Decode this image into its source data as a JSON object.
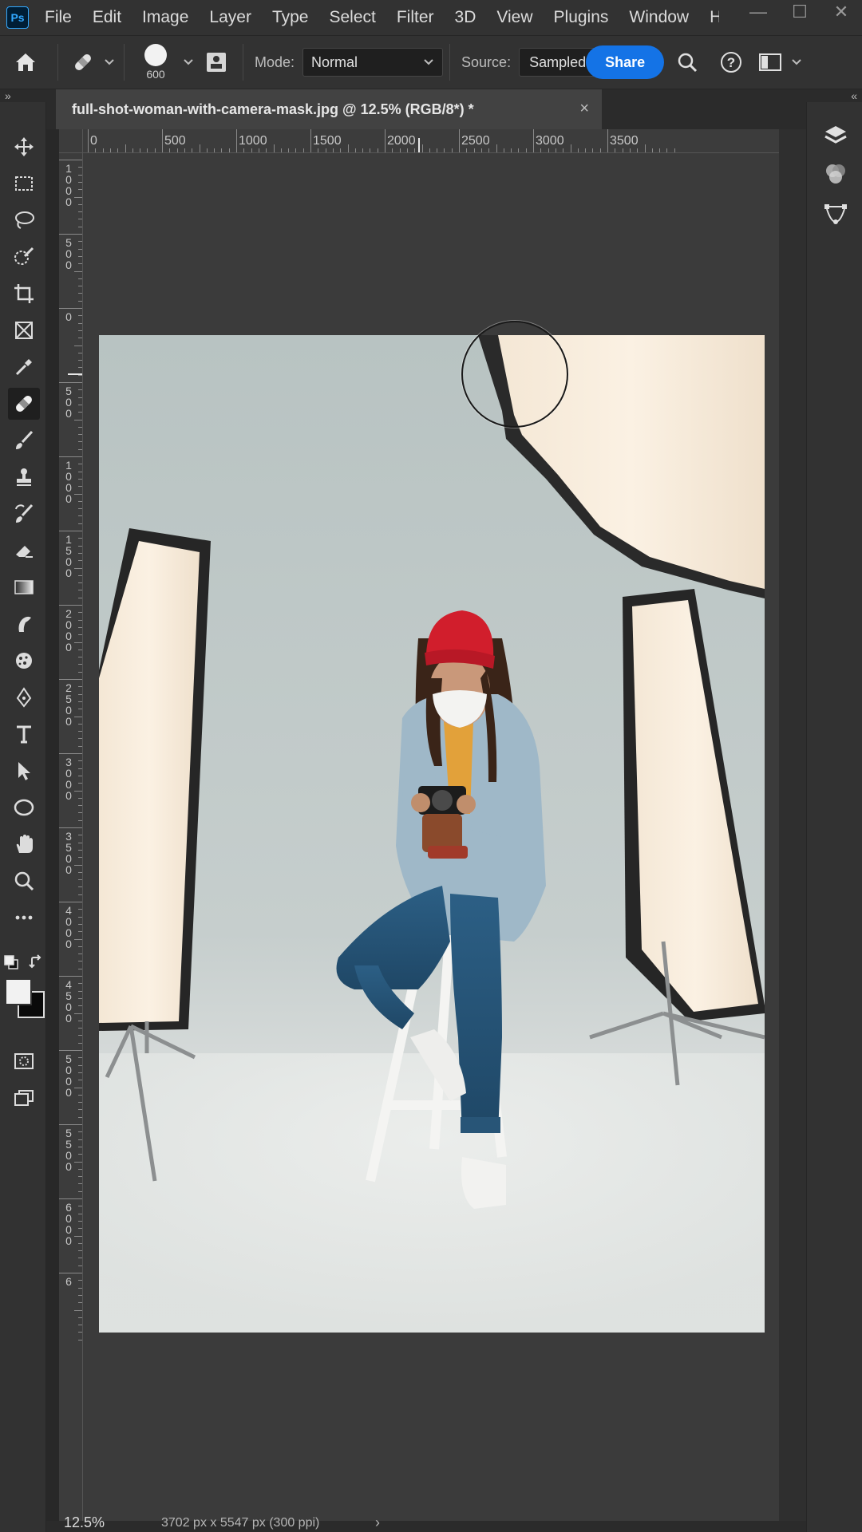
{
  "app": {
    "logo": "Ps"
  },
  "menu": [
    "File",
    "Edit",
    "Image",
    "Layer",
    "Type",
    "Select",
    "Filter",
    "3D",
    "View",
    "Plugins",
    "Window",
    "Help"
  ],
  "window_controls": {
    "minimize": "—",
    "maximize": "☐",
    "close": "✕"
  },
  "options": {
    "brush_size": "600",
    "mode_label": "Mode:",
    "mode_value": "Normal",
    "source_label": "Source:",
    "source_value": "Sampled",
    "share_label": "Share"
  },
  "collapse": {
    "left": "»",
    "right": "«"
  },
  "document": {
    "tab_title": "full-shot-woman-with-camera-mask.jpg @ 12.5% (RGB/8*) *",
    "close_glyph": "×"
  },
  "rulers": {
    "top_labels": [
      "0",
      "500",
      "1000",
      "1500",
      "2000",
      "2500",
      "3000",
      "3500"
    ],
    "left_labels": [
      "1000",
      "500",
      "0",
      "500",
      "1000",
      "1500",
      "2000",
      "2500",
      "3000",
      "3500",
      "4000",
      "4500",
      "5000",
      "5500",
      "6000",
      "6"
    ]
  },
  "tools": [
    {
      "name": "move-tool",
      "icon": "move-icon"
    },
    {
      "name": "rectangular-marquee-tool",
      "icon": "marquee-icon"
    },
    {
      "name": "lasso-tool",
      "icon": "lasso-icon"
    },
    {
      "name": "object-selection-tool",
      "icon": "quick-select-icon"
    },
    {
      "name": "crop-tool",
      "icon": "crop-icon"
    },
    {
      "name": "frame-tool",
      "icon": "frame-icon"
    },
    {
      "name": "eyedropper-tool",
      "icon": "eyedropper-icon"
    },
    {
      "name": "spot-healing-brush-tool",
      "icon": "bandage-icon",
      "active": true
    },
    {
      "name": "brush-tool",
      "icon": "brush-icon"
    },
    {
      "name": "clone-stamp-tool",
      "icon": "stamp-icon"
    },
    {
      "name": "history-brush-tool",
      "icon": "history-brush-icon"
    },
    {
      "name": "eraser-tool",
      "icon": "eraser-icon"
    },
    {
      "name": "gradient-tool",
      "icon": "gradient-icon"
    },
    {
      "name": "smudge-tool",
      "icon": "smudge-icon"
    },
    {
      "name": "sponge-tool",
      "icon": "sponge-icon"
    },
    {
      "name": "pen-tool",
      "icon": "pen-icon"
    },
    {
      "name": "type-tool",
      "icon": "type-icon"
    },
    {
      "name": "path-selection-tool",
      "icon": "arrow-icon"
    },
    {
      "name": "ellipse-tool",
      "icon": "ellipse-icon"
    },
    {
      "name": "hand-tool",
      "icon": "hand-icon"
    },
    {
      "name": "zoom-tool",
      "icon": "zoom-icon"
    },
    {
      "name": "edit-toolbar",
      "icon": "more-icon"
    }
  ],
  "colors": {
    "foreground": "#f2f2f2",
    "background": "#0a0a0a",
    "accent": "#1473e6"
  },
  "right_panel": [
    "layers-icon",
    "channels-icon",
    "paths-icon"
  ],
  "status": {
    "zoom": "12.5%",
    "doc_size": "3702 px x 5547 px (300 ppi)",
    "arrow": "›"
  }
}
